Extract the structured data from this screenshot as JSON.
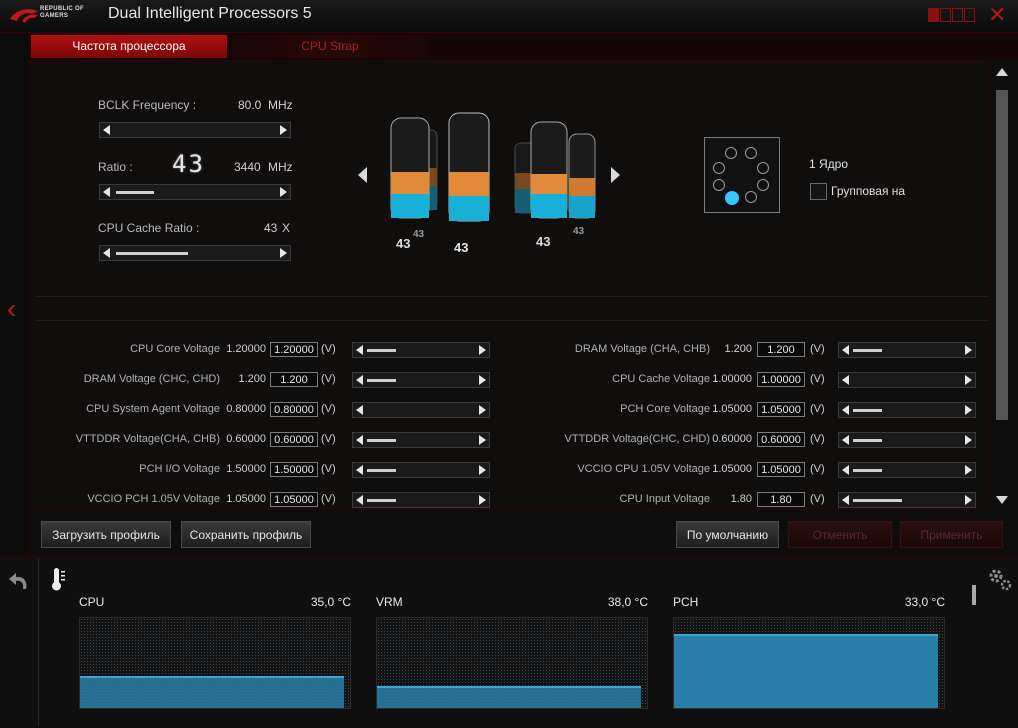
{
  "window": {
    "brand_line1": "REPUBLIC OF",
    "brand_line2": "GAMERS",
    "title": "Dual Intelligent Processors 5",
    "close_symbol": "✕",
    "accent_color": "#b30f0f"
  },
  "tabs": [
    {
      "label": "Частота процессора",
      "active": true
    },
    {
      "label": "CPU Strap",
      "active": false
    }
  ],
  "freq": {
    "bclk_label": "BCLK Frequency :",
    "bclk_value": "80.0",
    "bclk_unit": "MHz",
    "ratio_label": "Ratio :",
    "ratio_big": "43",
    "ratio_value": "3440",
    "ratio_unit": "MHz",
    "cache_label": "CPU Cache Ratio :",
    "cache_value": "43",
    "cache_unit": "X"
  },
  "cores_visual": {
    "labels": [
      "43",
      "43",
      "43",
      "43",
      "43"
    ]
  },
  "core_selector": {
    "core_label": "1 Ядро",
    "group_label": "Групповая на"
  },
  "voltages_left": [
    {
      "label": "CPU Core Voltage",
      "value": "1.20000",
      "input": "1.20000",
      "unit": "(V)",
      "thumb": 0.3
    },
    {
      "label": "DRAM Voltage (CHC, CHD)",
      "value": "1.200",
      "input": "1.200",
      "unit": "(V)",
      "thumb": 0.3
    },
    {
      "label": "CPU System Agent Voltage",
      "value": "0.80000",
      "input": "0.80000",
      "unit": "(V)",
      "thumb": 0.0
    },
    {
      "label": "VTTDDR Voltage(CHA, CHB)",
      "value": "0.60000",
      "input": "0.60000",
      "unit": "(V)",
      "thumb": 0.3
    },
    {
      "label": "PCH I/O Voltage",
      "value": "1.50000",
      "input": "1.50000",
      "unit": "(V)",
      "thumb": 0.3
    },
    {
      "label": "VCCIO PCH 1.05V Voltage",
      "value": "1.05000",
      "input": "1.05000",
      "unit": "(V)",
      "thumb": 0.3
    }
  ],
  "voltages_right": [
    {
      "label": "DRAM Voltage (CHA, CHB)",
      "value": "1.200",
      "input": "1.200",
      "unit": "(V)",
      "thumb": 0.3
    },
    {
      "label": "CPU Cache Voltage",
      "value": "1.00000",
      "input": "1.00000",
      "unit": "(V)",
      "thumb": 0.0
    },
    {
      "label": "PCH Core Voltage",
      "value": "1.05000",
      "input": "1.05000",
      "unit": "(V)",
      "thumb": 0.3
    },
    {
      "label": "VTTDDR Voltage(CHC, CHD)",
      "value": "0.60000",
      "input": "0.60000",
      "unit": "(V)",
      "thumb": 0.3
    },
    {
      "label": "VCCIO CPU 1.05V Voltage",
      "value": "1.05000",
      "input": "1.05000",
      "unit": "(V)",
      "thumb": 0.3
    },
    {
      "label": "CPU Input Voltage",
      "value": "1.80",
      "input": "1.80",
      "unit": "(V)",
      "thumb": 0.5
    }
  ],
  "buttons": {
    "load_profile": "Загрузить профиль",
    "save_profile": "Сохранить профиль",
    "default": "По умолчанию",
    "cancel": "Отменить",
    "apply": "Применить"
  },
  "monitor": {
    "sensors": [
      {
        "name": "CPU",
        "value": "35,0 °C",
        "level": 0.33
      },
      {
        "name": "VRM",
        "value": "38,0 °C",
        "level": 0.22
      },
      {
        "name": "PCH",
        "value": "33,0 °C",
        "level": 0.78
      }
    ]
  }
}
